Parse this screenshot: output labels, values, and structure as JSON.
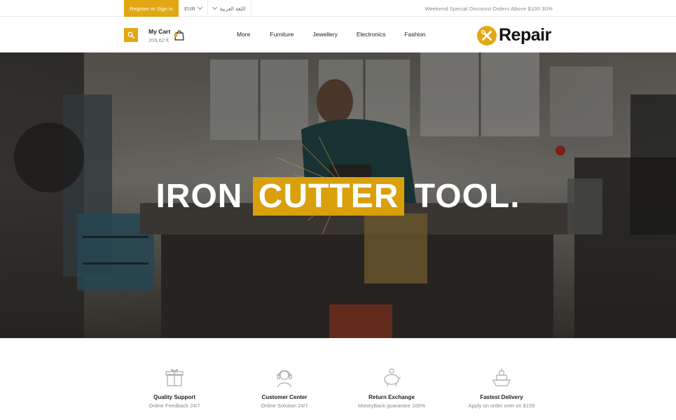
{
  "topbar": {
    "register_label": "Register or Sign in",
    "currency": "EUR",
    "language": "اللغة العربية",
    "promo": "Weekend Special Discount Orders Above $100 30%"
  },
  "header": {
    "cart_title": "My Cart",
    "cart_total": "209,62 €",
    "nav": [
      "More",
      "Furniture",
      "Jewellery",
      "Electronics",
      "Fashion"
    ],
    "logo_text": "Repair"
  },
  "hero": {
    "title_part1": "IRON",
    "title_highlight": "CUTTER",
    "title_part2": "TOOL."
  },
  "features": [
    {
      "icon": "gift-icon",
      "title": "Quality Support",
      "subtitle": "Online Feedback 24/7"
    },
    {
      "icon": "headset-icon",
      "title": "Customer Center",
      "subtitle": "Online Solution 24/7"
    },
    {
      "icon": "piggy-bank-icon",
      "title": "Return Exchange",
      "subtitle": "MoneyBack guarantee 100%"
    },
    {
      "icon": "ship-icon",
      "title": "Fastest Delivery",
      "subtitle": "Apply on order over on $159"
    }
  ],
  "colors": {
    "accent": "#e3a711",
    "hero_highlight": "#d9a00c"
  }
}
